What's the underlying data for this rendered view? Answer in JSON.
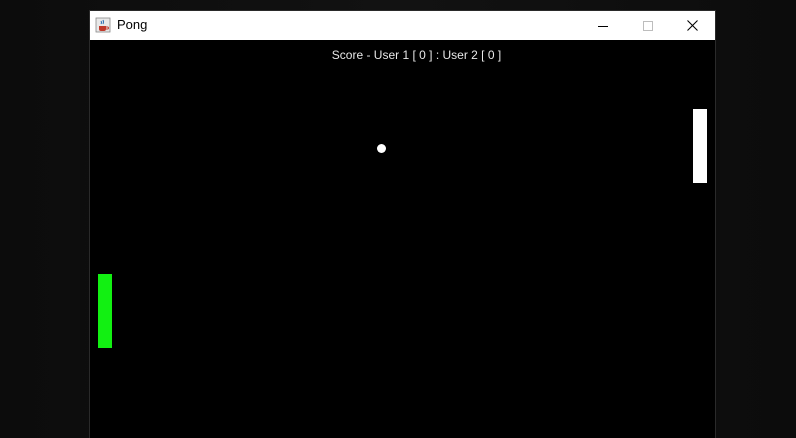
{
  "window": {
    "title": "Pong",
    "icon": "java-cup-icon",
    "controls": [
      "minimize-icon",
      "maximize-icon",
      "close-icon"
    ]
  },
  "game": {
    "score_text": "Score - User 1 [ 0 ] : User 2 [ 0 ]",
    "colors": {
      "background": "#000000",
      "left_paddle": "#12f012",
      "right_paddle": "#ffffff",
      "ball": "#ffffff",
      "score_text": "#e8e8e8"
    }
  }
}
